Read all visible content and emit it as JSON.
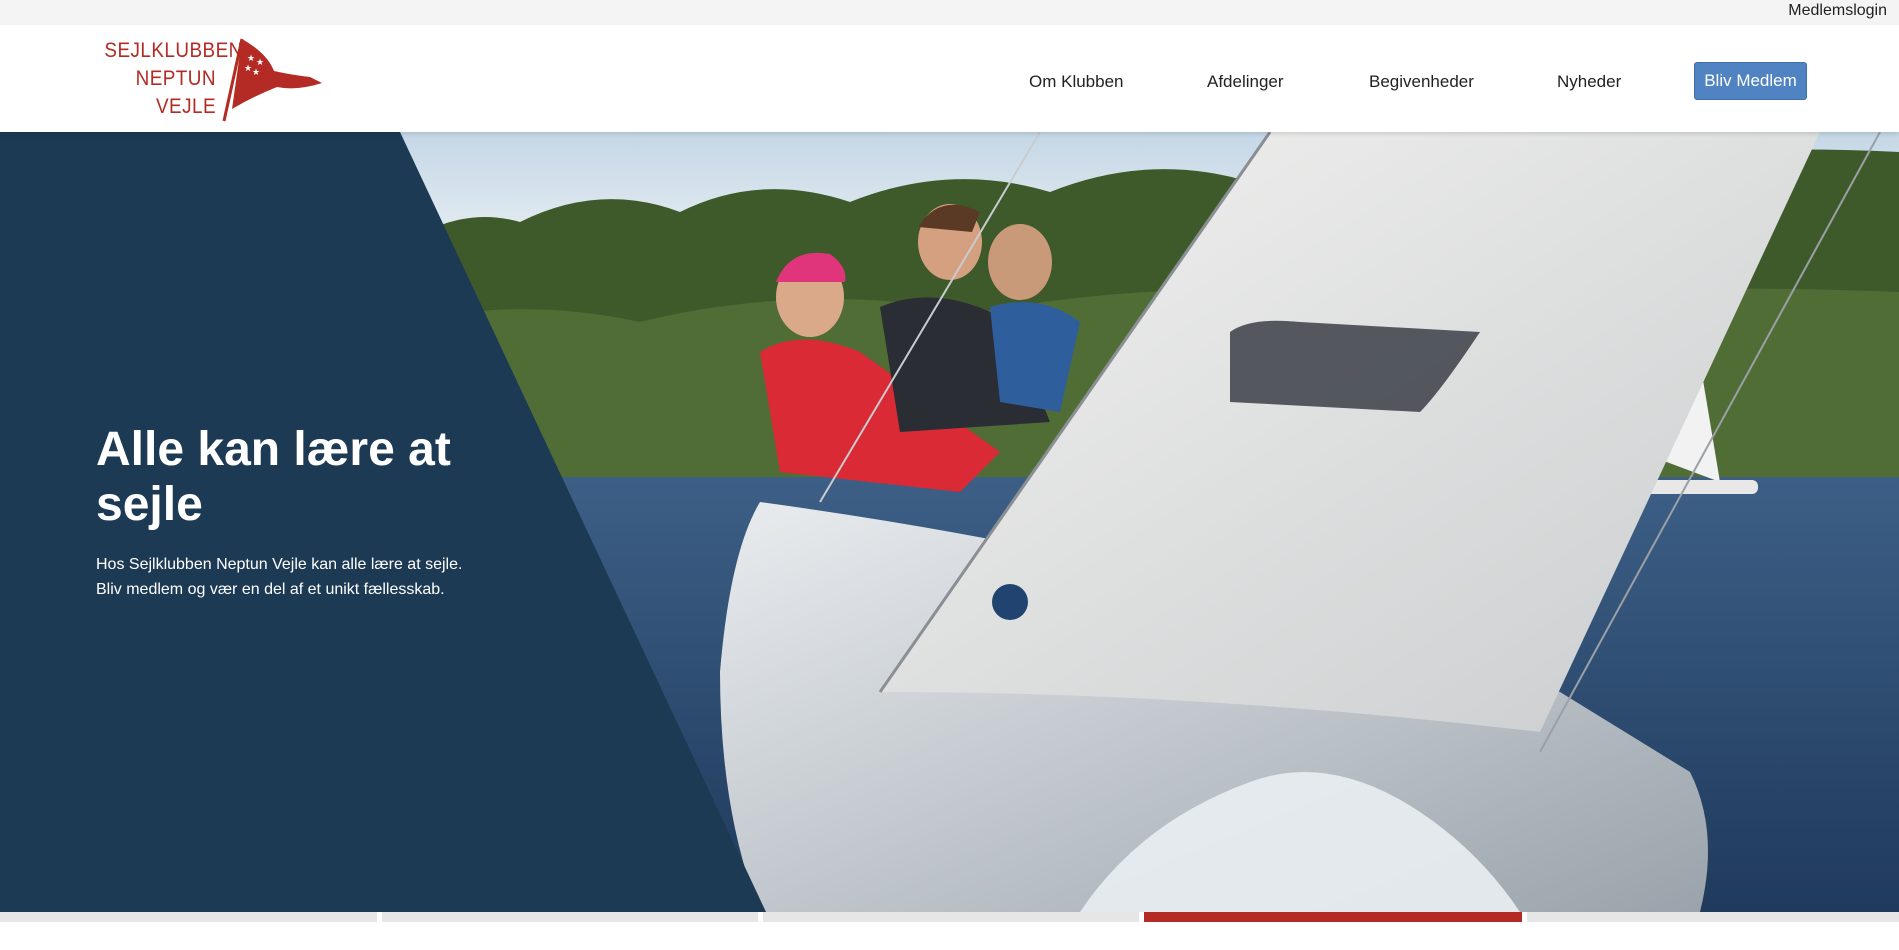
{
  "topbar": {
    "login_label": "Medlemslogin"
  },
  "logo": {
    "line1": "SEJLKLUBBEN",
    "line2": "NEPTUN",
    "line3": "VEJLE",
    "color": "#b42a24"
  },
  "nav": {
    "items": [
      {
        "label": "Om Klubben"
      },
      {
        "label": "Afdelinger"
      },
      {
        "label": "Begivenheder"
      },
      {
        "label": "Nyheder"
      }
    ],
    "cta_label": "Bliv Medlem",
    "cta_color": "#4f83c2"
  },
  "hero": {
    "title": "Alle kan lære at sejle",
    "subtitle_line1": "Hos Sejlklubben Neptun Vejle kan alle lære at sejle.",
    "subtitle_line2": "Bliv medlem og vær en del af et unikt fællesskab.",
    "panel_color": "#1d3a55",
    "image": "sailboat-photo"
  },
  "slider": {
    "slide_count": 5,
    "active_index": 3,
    "active_color": "#b42a24"
  }
}
